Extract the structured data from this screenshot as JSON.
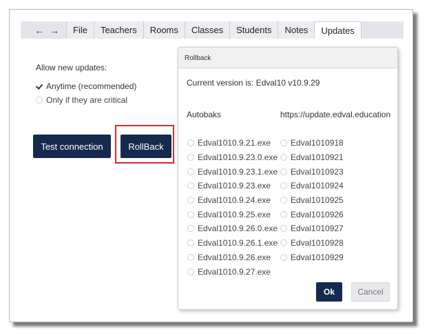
{
  "nav": {
    "back_icon": "←",
    "forward_icon": "→"
  },
  "tabs": [
    {
      "label": "File"
    },
    {
      "label": "Teachers"
    },
    {
      "label": "Rooms"
    },
    {
      "label": "Classes"
    },
    {
      "label": "Students"
    },
    {
      "label": "Notes"
    },
    {
      "label": "Updates",
      "active": true
    }
  ],
  "updates": {
    "heading": "Allow new updates:",
    "options": [
      {
        "label": "Anytime (recommended)",
        "selected": true
      },
      {
        "label": "Only if they are critical",
        "selected": false
      }
    ],
    "test_connection_label": "Test connection",
    "rollback_label": "RollBack"
  },
  "dialog": {
    "title": "Rollback",
    "version_text": "Current version is: Edval10 v10.9.29",
    "autobaks_heading": "Autobaks",
    "remote_heading": "https://update.edval.education",
    "autobaks": [
      "Edval1010.9.21.exe",
      "Edval1010.9.23.0.exe",
      "Edval1010.9.23.1.exe",
      "Edval1010.9.23.exe",
      "Edval1010.9.24.exe",
      "Edval1010.9.25.exe",
      "Edval1010.9.26.0.exe",
      "Edval1010.9.26.1.exe",
      "Edval1010.9.26.exe",
      "Edval1010.9.27.exe"
    ],
    "remote": [
      "Edval1010918",
      "Edval1010921",
      "Edval1010923",
      "Edval1010924",
      "Edval1010925",
      "Edval1010926",
      "Edval1010927",
      "Edval1010928",
      "Edval1010929"
    ],
    "ok_label": "Ok",
    "cancel_label": "Cancel"
  },
  "colors": {
    "primary": "#142a4e",
    "highlight": "#d9262c"
  }
}
